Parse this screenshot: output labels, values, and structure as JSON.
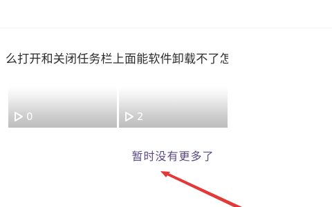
{
  "article": {
    "title": "么打开和关闭任务栏上面能软件卸载不了怎么办"
  },
  "videos": [
    {
      "views": "0",
      "icon": "play-icon"
    },
    {
      "views": "2",
      "icon": "play-icon"
    }
  ],
  "feed": {
    "end_text": "暂时没有更多了"
  },
  "colors": {
    "end_text": "#5a4a86",
    "annotation_arrow": "#e23a3a"
  }
}
